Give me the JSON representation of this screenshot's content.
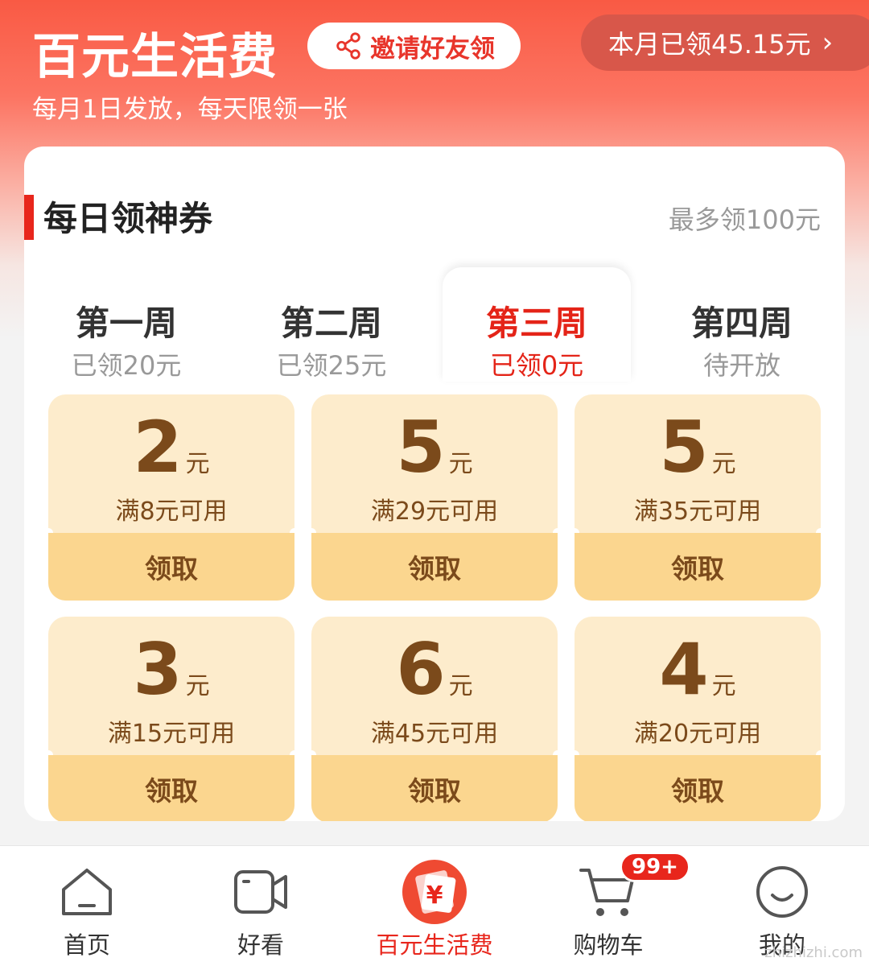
{
  "header": {
    "title": "百元生活费",
    "invite_label": "邀请好友领",
    "month_claimed": "本月已领45.15元",
    "subtitle": "每月1日发放，每天限领一张"
  },
  "section": {
    "title": "每日领神券",
    "max_note": "最多领100元"
  },
  "weeks": [
    {
      "name": "第一周",
      "status": "已领20元"
    },
    {
      "name": "第二周",
      "status": "已领25元"
    },
    {
      "name": "第三周",
      "status": "已领0元"
    },
    {
      "name": "第四周",
      "status": "待开放"
    }
  ],
  "coupons": [
    {
      "amount": "2",
      "unit": "元",
      "condition": "满8元可用",
      "action": "领取"
    },
    {
      "amount": "5",
      "unit": "元",
      "condition": "满29元可用",
      "action": "领取"
    },
    {
      "amount": "5",
      "unit": "元",
      "condition": "满35元可用",
      "action": "领取"
    },
    {
      "amount": "3",
      "unit": "元",
      "condition": "满15元可用",
      "action": "领取"
    },
    {
      "amount": "6",
      "unit": "元",
      "condition": "满45元可用",
      "action": "领取"
    },
    {
      "amount": "4",
      "unit": "元",
      "condition": "满20元可用",
      "action": "领取"
    }
  ],
  "nav": {
    "items": [
      {
        "label": "首页",
        "icon": "home-icon"
      },
      {
        "label": "好看",
        "icon": "video-icon"
      },
      {
        "label": "百元生活费",
        "icon": "red-envelope-icon"
      },
      {
        "label": "购物车",
        "icon": "cart-icon"
      },
      {
        "label": "我的",
        "icon": "profile-icon"
      }
    ],
    "cart_badge": "99+"
  },
  "watermark": "zhizhizhi.com",
  "colors": {
    "accent": "#e8261c",
    "coupon_bg": "#fdeccc",
    "coupon_button": "#fbd68f",
    "coupon_text": "#7b4a1b"
  }
}
